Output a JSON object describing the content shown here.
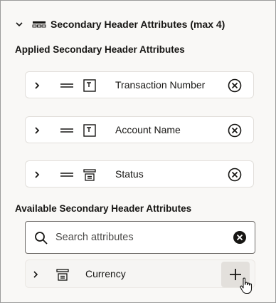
{
  "section": {
    "title": "Secondary Header Attributes (max 4)",
    "expanded": true
  },
  "applied": {
    "heading": "Applied Secondary Header Attributes",
    "items": [
      {
        "label": "Transaction Number",
        "icon": "text-field-icon"
      },
      {
        "label": "Account Name",
        "icon": "text-field-icon"
      },
      {
        "label": "Status",
        "icon": "list-field-icon"
      }
    ]
  },
  "available": {
    "heading": "Available Secondary Header Attributes",
    "search": {
      "placeholder": "Search attributes",
      "value": ""
    },
    "items": [
      {
        "label": "Currency",
        "icon": "list-field-icon"
      }
    ]
  },
  "colors": {
    "text": "#161513",
    "panel_background": "#f9f8f6",
    "card_background": "#ffffff",
    "add_button_background": "#e3e0dc"
  }
}
